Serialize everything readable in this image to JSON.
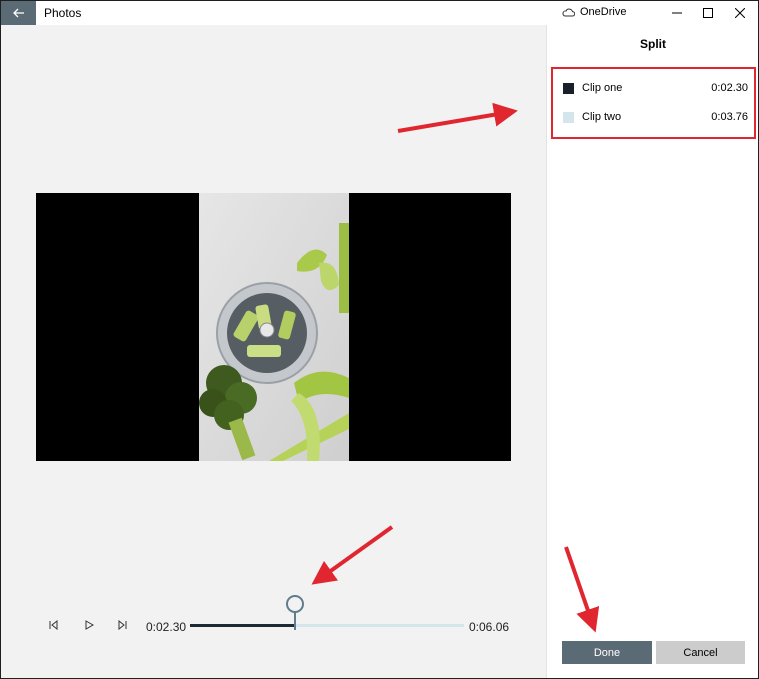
{
  "titlebar": {
    "app_title": "Photos",
    "onedrive_label": "OneDrive",
    "back_icon": "back-arrow-icon",
    "controls": [
      "minimize-icon",
      "maximize-icon",
      "close-icon"
    ]
  },
  "player": {
    "current_time": "0:02.30",
    "total_time": "0:06.06",
    "progress_fraction": 0.38,
    "controls": [
      "previous-frame-icon",
      "play-icon",
      "next-frame-icon"
    ]
  },
  "panel": {
    "title": "Split",
    "clips": [
      {
        "name": "Clip one",
        "duration": "0:02.30",
        "color": "#18202a"
      },
      {
        "name": "Clip two",
        "duration": "0:03.76",
        "color": "#d4e6ec"
      }
    ],
    "done_label": "Done",
    "cancel_label": "Cancel"
  },
  "colors": {
    "accent": "#5b6b76",
    "annotation": "#e0262e"
  }
}
